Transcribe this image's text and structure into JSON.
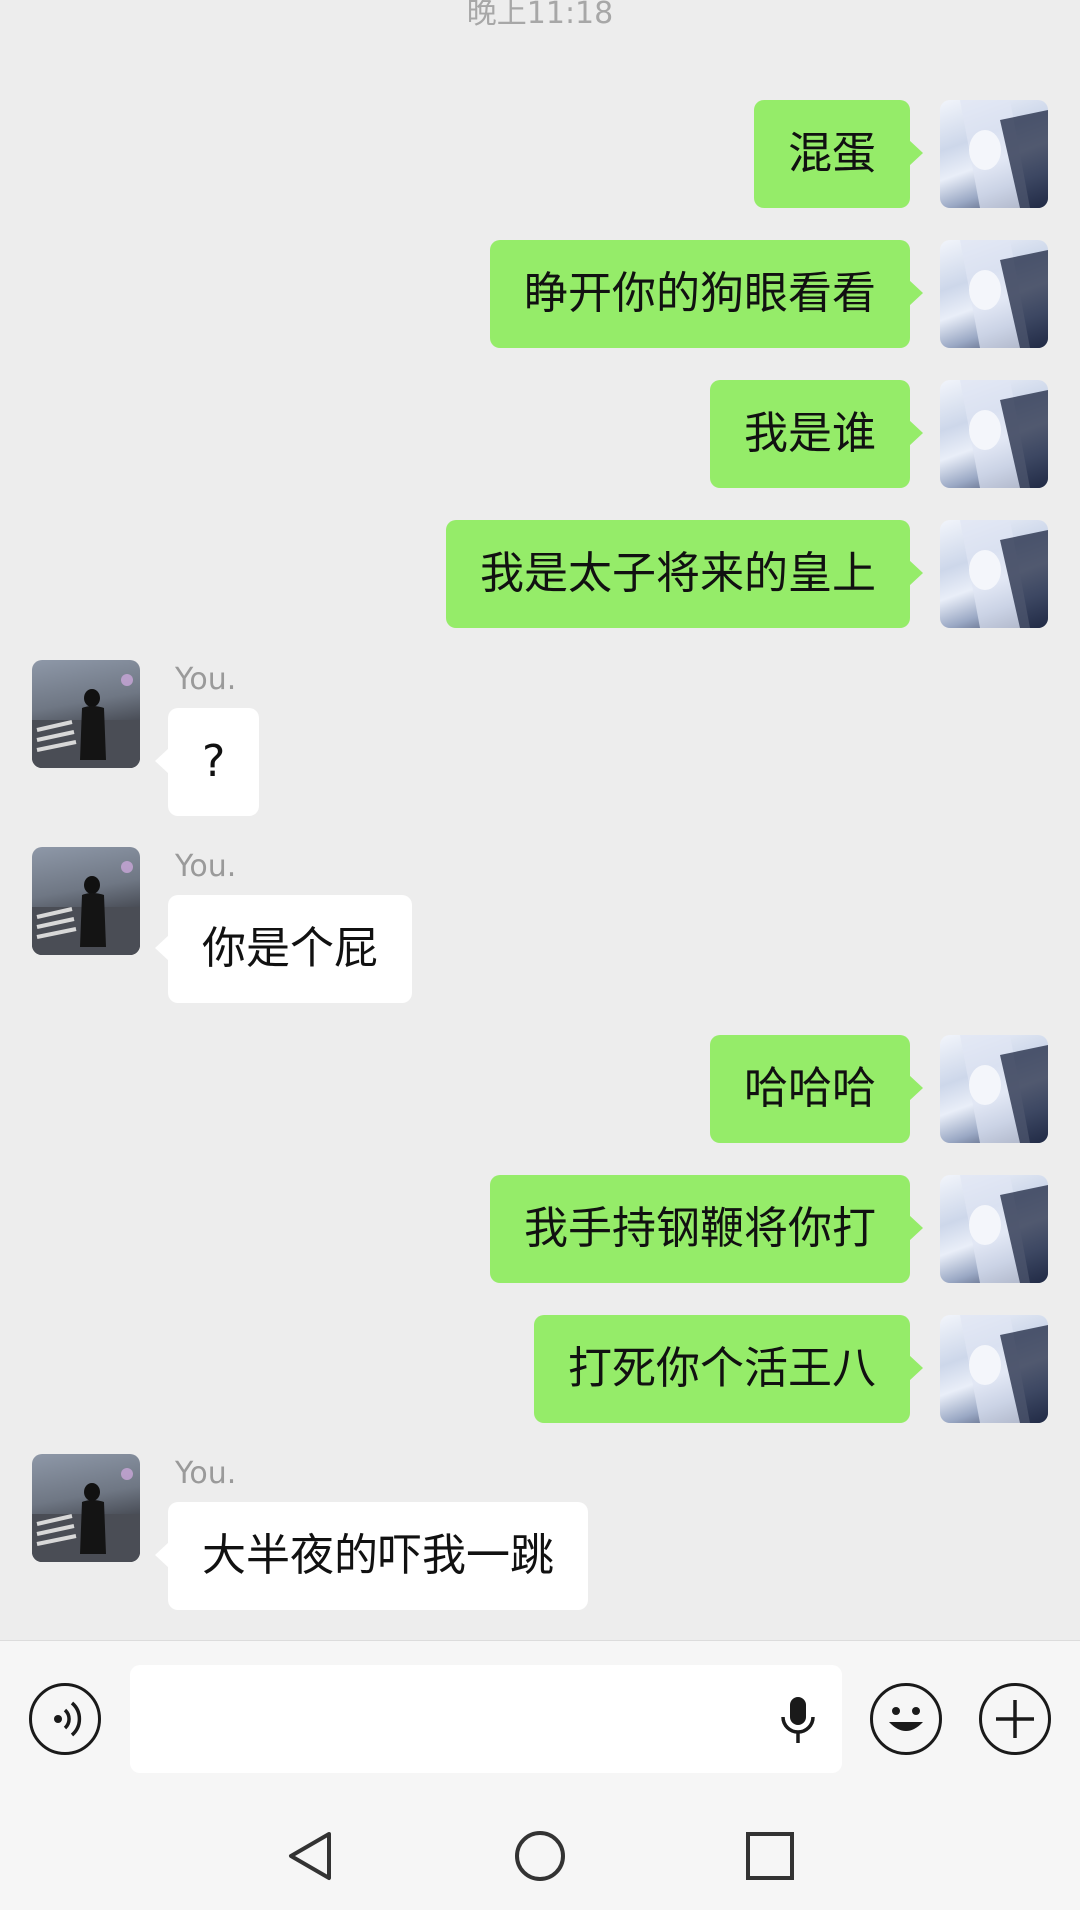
{
  "chat": {
    "timestamp": "晚上11:18",
    "messages": [
      {
        "side": "me",
        "text": "混蛋"
      },
      {
        "side": "me",
        "text": "睁开你的狗眼看看"
      },
      {
        "side": "me",
        "text": "我是谁"
      },
      {
        "side": "me",
        "text": "我是太子将来的皇上"
      },
      {
        "side": "other",
        "sender": "You.",
        "text": "?"
      },
      {
        "side": "other",
        "sender": "You.",
        "text": "你是个屁"
      },
      {
        "side": "me",
        "text": "哈哈哈"
      },
      {
        "side": "me",
        "text": "我手持钢鞭将你打"
      },
      {
        "side": "me",
        "text": "打死你个活王八"
      },
      {
        "side": "other",
        "sender": "You.",
        "text": "大半夜的吓我一跳"
      }
    ]
  },
  "input": {
    "placeholder": "",
    "icons": [
      "voice-icon",
      "microphone-icon",
      "emoji-icon",
      "plus-icon"
    ]
  },
  "navbar": {
    "icons": [
      "back-triangle-icon",
      "home-circle-icon",
      "recents-square-icon"
    ]
  },
  "colors": {
    "background": "#ededed",
    "my_bubble": "#95ec69",
    "other_bubble": "#ffffff",
    "timestamp_text": "#a7a7a7",
    "sender_text": "#9a9a9a"
  }
}
